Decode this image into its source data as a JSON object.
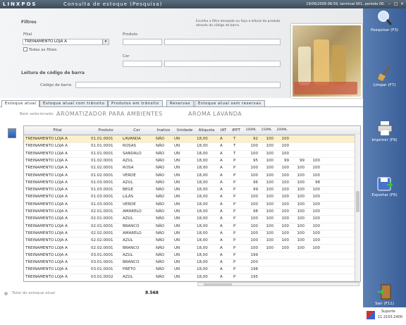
{
  "titlebar": {
    "logo": "LINXPOS",
    "title": "Consulta de estoque (Pesquisa)",
    "status": "19/06/2009 08:59, terminal 001, período 00."
  },
  "filters": {
    "header": "Filtros",
    "filial_label": "Filial",
    "filial_value": "TREINAMENTO LOJA A",
    "todas_filiais": "Todas as filiais",
    "produto_label": "Produto",
    "cor_label": "Cor",
    "hint": "Escolha o filtro desejado ou faça a leitura do produto através do código de barra.",
    "barcode_header": "Leitura de código de barra",
    "barcode_label": "Código de barra"
  },
  "tabs": [
    "Estoque atual",
    "Estoque atual com trânsito",
    "Produtos em trânsito",
    "Reservas",
    "Estoque atual sem reservas"
  ],
  "selected": {
    "label": "Bem selecionado:",
    "product": "AROMATIZADOR PARA AMBIENTES",
    "variant": "AROMA LAVANDA"
  },
  "table": {
    "columns": [
      "Filial",
      "Produto",
      "Cor",
      "Inativo",
      "Unidade",
      "Alíquota",
      "IAT",
      "IPPT",
      "100ML",
      "150ML",
      "200ML"
    ],
    "rows": [
      [
        "TREINAMENTO LOJA A",
        "01.01.0001",
        "LAVANDA",
        "NÃO",
        "UN",
        "18,00",
        "A",
        "T",
        "92",
        "100",
        "100",
        "",
        ""
      ],
      [
        "TREINAMENTO LOJA A",
        "01.01.0001",
        "ROSAS",
        "NÃO",
        "UN",
        "18,00",
        "A",
        "T",
        "100",
        "100",
        "100",
        "",
        ""
      ],
      [
        "TREINAMENTO LOJA A",
        "01.01.0001",
        "SANDALO",
        "NÃO",
        "UN",
        "18,00",
        "A",
        "T",
        "100",
        "100",
        "100",
        "",
        ""
      ],
      [
        "TREINAMENTO LOJA A",
        "01.02.0001",
        "AZUL",
        "NÃO",
        "UN",
        "18,00",
        "A",
        "P",
        "95",
        "100",
        "99",
        "99",
        "100"
      ],
      [
        "TREINAMENTO LOJA A",
        "01.02.0001",
        "ROSA",
        "NÃO",
        "UN",
        "18,00",
        "A",
        "P",
        "100",
        "100",
        "100",
        "100",
        "100"
      ],
      [
        "TREINAMENTO LOJA A",
        "01.02.0001",
        "VERDE",
        "NÃO",
        "UN",
        "18,00",
        "A",
        "P",
        "100",
        "100",
        "100",
        "100",
        "100"
      ],
      [
        "TREINAMENTO LOJA A",
        "01.03.0001",
        "AZUL",
        "NÃO",
        "UN",
        "18,00",
        "A",
        "P",
        "96",
        "100",
        "100",
        "100",
        "98"
      ],
      [
        "TREINAMENTO LOJA A",
        "01.03.0001",
        "BEGE",
        "NÃO",
        "UN",
        "18,00",
        "A",
        "P",
        "99",
        "100",
        "100",
        "100",
        "100"
      ],
      [
        "TREINAMENTO LOJA A",
        "01.03.0001",
        "LILÁS",
        "NÃO",
        "UN",
        "18,00",
        "A",
        "P",
        "100",
        "100",
        "100",
        "100",
        "100"
      ],
      [
        "TREINAMENTO LOJA A",
        "01.03.0001",
        "VERDE",
        "NÃO",
        "UN",
        "18,00",
        "A",
        "P",
        "100",
        "100",
        "100",
        "100",
        "100"
      ],
      [
        "TREINAMENTO LOJA A",
        "02.01.0001",
        "AMARELO",
        "NÃO",
        "UN",
        "18,00",
        "A",
        "P",
        "98",
        "100",
        "100",
        "100",
        "100"
      ],
      [
        "TREINAMENTO LOJA A",
        "02.01.0001",
        "AZUL",
        "NÃO",
        "UN",
        "18,00",
        "A",
        "P",
        "100",
        "100",
        "100",
        "100",
        "100"
      ],
      [
        "TREINAMENTO LOJA A",
        "02.01.0001",
        "BRANCO",
        "NÃO",
        "UN",
        "18,00",
        "A",
        "P",
        "100",
        "100",
        "100",
        "100",
        "100"
      ],
      [
        "TREINAMENTO LOJA A",
        "02.02.0001",
        "AMARELO",
        "NÃO",
        "UN",
        "18,00",
        "A",
        "P",
        "100",
        "100",
        "100",
        "100",
        "100"
      ],
      [
        "TREINAMENTO LOJA A",
        "02.02.0001",
        "AZUL",
        "NÃO",
        "UN",
        "18,00",
        "A",
        "P",
        "100",
        "100",
        "100",
        "100",
        "100"
      ],
      [
        "TREINAMENTO LOJA A",
        "02.02.0001",
        "BRANCO",
        "NÃO",
        "UN",
        "18,00",
        "A",
        "P",
        "100",
        "100",
        "100",
        "100",
        "100"
      ],
      [
        "TREINAMENTO LOJA A",
        "03.01.0001",
        "AZUL",
        "NÃO",
        "UN",
        "18,00",
        "A",
        "P",
        "199",
        "",
        "",
        "",
        ""
      ],
      [
        "TREINAMENTO LOJA A",
        "03.01.0001",
        "BRANCO",
        "NÃO",
        "UN",
        "18,00",
        "A",
        "P",
        "200",
        "",
        "",
        "",
        ""
      ],
      [
        "TREINAMENTO LOJA A",
        "03.01.0001",
        "PRETO",
        "NÃO",
        "UN",
        "18,00",
        "A",
        "P",
        "198",
        "",
        "",
        "",
        ""
      ],
      [
        "TREINAMENTO LOJA A",
        "03.01.0002",
        "AZUL",
        "NÃO",
        "UN",
        "18,00",
        "A",
        "P",
        "195",
        "",
        "",
        "",
        ""
      ]
    ]
  },
  "footer": {
    "total_label": "Total do estoque atual",
    "total_value": "8.568"
  },
  "actions": [
    {
      "label": "Pesquisar (F3)",
      "icon": "magnifier-icon"
    },
    {
      "label": "Limpar (F7)",
      "icon": "broom-icon"
    },
    {
      "label": "Imprimir (F9)",
      "icon": "printer-icon"
    },
    {
      "label": "Exportar (F6)",
      "icon": "export-disk-icon"
    },
    {
      "label": "Sair (F11)",
      "icon": "exit-door-icon"
    }
  ],
  "support": {
    "label": "Suporte",
    "version": "11.2103.2400"
  }
}
